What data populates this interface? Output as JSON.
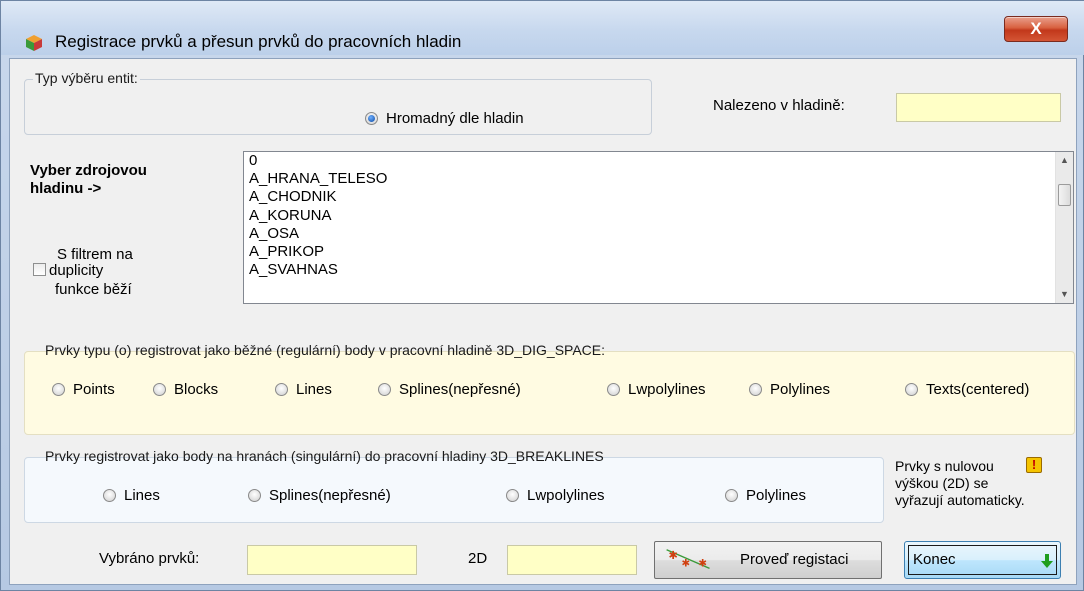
{
  "window": {
    "title": "Registrace prvků a přesun prvků do pracovních hladin",
    "close_glyph": "X"
  },
  "selection_type": {
    "legend": "Typ  výběru entit:",
    "option_label": "Hromadný dle hladin",
    "selected": true
  },
  "found_in_layer": {
    "label": "Nalezeno v hladině:",
    "value": ""
  },
  "source_layer": {
    "label_line1": "Vyber zdrojovou",
    "label_line2": "hladinu ->",
    "items": [
      "0",
      "A_HRANA_TELESO",
      "A_CHODNIK",
      "A_KORUNA",
      "A_OSA",
      "A_PRIKOP",
      "A_SVAHNAS"
    ]
  },
  "duplicity_filter": {
    "line1": "S filtrem na",
    "line2": "duplicity",
    "line3": "funkce běží",
    "checked": false
  },
  "regular_group": {
    "legend": "Prvky typu (o) registrovat jako běžné (regulární) body v pracovní hladině 3D_DIG_SPACE:",
    "options": [
      "Points",
      "Blocks",
      "Lines",
      "Splines(nepřesné)",
      "Lwpolylines",
      "Polylines",
      "Texts(centered)"
    ]
  },
  "breaklines_group": {
    "legend": "Prvky registrovat jako body na hranách (singulární) do pracovní hladiny 3D_BREAKLINES",
    "options": [
      "Lines",
      "Splines(nepřesné)",
      "Lwpolylines",
      "Polylines"
    ]
  },
  "zero_height_note": {
    "line1": "Prvky s nulovou",
    "line2": "výškou (2D) se",
    "line3": "vyřazují automaticky.",
    "icon": "warning-icon",
    "glyph": "!"
  },
  "footer": {
    "selected_count_label": "Vybráno prvků:",
    "selected_count_value": "",
    "twod_label": "2D",
    "twod_value": "",
    "register_button": "Proveď registaci",
    "end_button": "Konec"
  },
  "colors": {
    "field_bg": "#ffffc6",
    "regular_group_bg": "#fffbe2",
    "breaklines_group_bg": "#f5f9fd",
    "close_red": "#c2381b"
  }
}
